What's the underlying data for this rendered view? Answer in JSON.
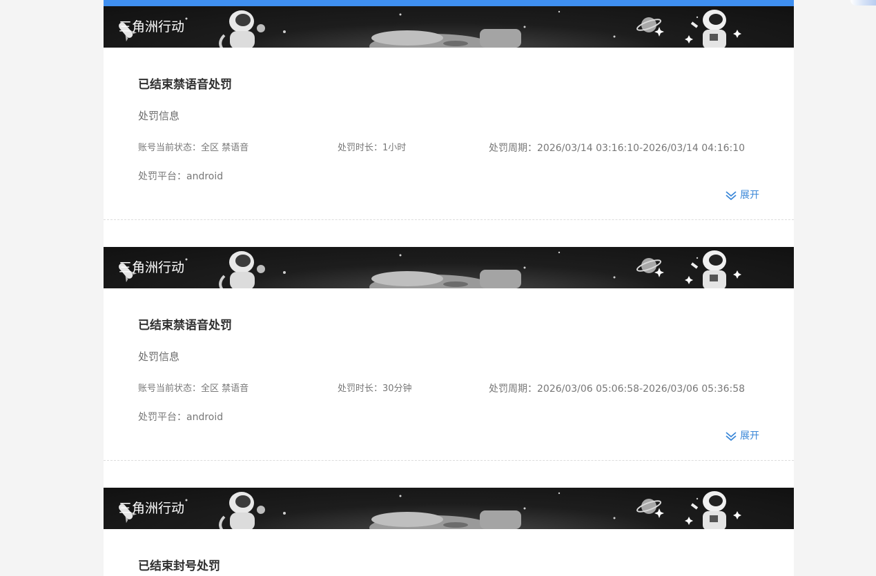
{
  "game_title": "三角洲行动",
  "section_label": "处罚信息",
  "expand_label": "展开",
  "colors": {
    "accent": "#3f8ff0",
    "link": "#3a87d8"
  },
  "cards": [
    {
      "title": "已结束禁语音处罚",
      "status": "账号当前状态：全区 禁语音",
      "duration": "处罚时长：1小时",
      "period": "处罚周期：2026/03/14 03:16:10-2026/03/14 04:16:10",
      "platform": "处罚平台：android"
    },
    {
      "title": "已结束禁语音处罚",
      "status": "账号当前状态：全区 禁语音",
      "duration": "处罚时长：30分钟",
      "period": "处罚周期：2026/03/06 05:06:58-2026/03/06 05:36:58",
      "platform": "处罚平台：android"
    },
    {
      "title": "已结束封号处罚"
    }
  ]
}
